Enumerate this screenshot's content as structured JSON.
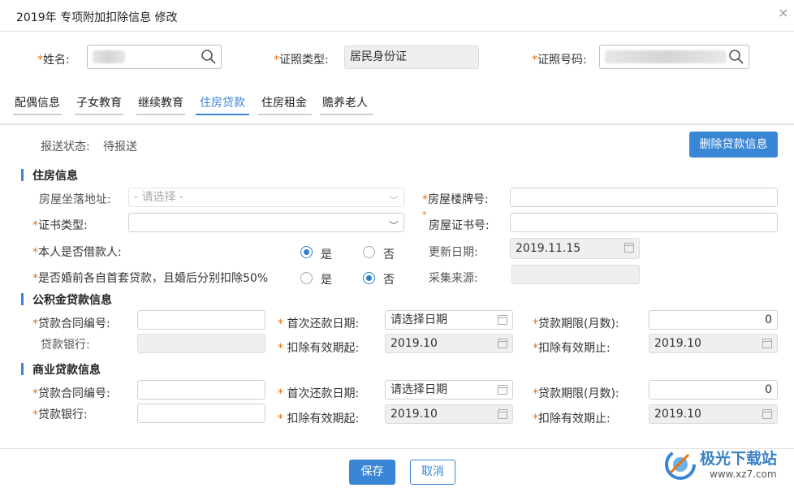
{
  "dialog": {
    "title": "2019年 专项附加扣除信息 修改",
    "close_icon": "×"
  },
  "header": {
    "name_label": "姓名:",
    "id_type_label": "证照类型:",
    "id_type_value": "居民身份证",
    "id_no_label": "证照号码:"
  },
  "tabs": [
    "配偶信息",
    "子女教育",
    "继续教育",
    "住房贷款",
    "住房租金",
    "赡养老人"
  ],
  "status": {
    "label": "报送状态:",
    "value": "待报送",
    "delete_button": "删除贷款信息"
  },
  "housing": {
    "title": "住房信息",
    "address_label": "房屋坐落地址:",
    "address_placeholder": "- 请选择 -",
    "building_label": "房屋楼牌号:",
    "cert_type_label": "证书类型:",
    "cert_no_label": "房屋证书号:",
    "is_borrower_label": "本人是否借款人:",
    "yes": "是",
    "no": "否",
    "update_date_label": "更新日期:",
    "update_date_value": "2019.11.15",
    "premarital_label": "是否婚前各自首套贷款，且婚后分别扣除50%",
    "source_label": "采集来源:"
  },
  "fund_loan": {
    "title": "公积金贷款信息",
    "contract_label": "贷款合同编号:",
    "first_repay_label": "首次还款日期:",
    "first_repay_value": "请选择日期",
    "term_label": "贷款期限(月数):",
    "term_value": "0",
    "bank_label": "贷款银行:",
    "start_label": "扣除有效期起:",
    "start_value": "2019.10",
    "end_label": "扣除有效期止:",
    "end_value": "2019.10"
  },
  "commercial_loan": {
    "title": "商业贷款信息",
    "contract_label": "贷款合同编号:",
    "first_repay_label": "首次还款日期:",
    "first_repay_value": "请选择日期",
    "term_label": "贷款期限(月数):",
    "term_value": "0",
    "bank_label": "贷款银行:",
    "start_label": "扣除有效期起:",
    "start_value": "2019.10",
    "end_label": "扣除有效期止:",
    "end_value": "2019.10"
  },
  "footer": {
    "save": "保存",
    "cancel": "取消"
  },
  "watermark": {
    "text": "极光下载站",
    "url": "www.xz7.com"
  },
  "colors": {
    "accent": "#3a86d6",
    "required": "#e6730f"
  }
}
